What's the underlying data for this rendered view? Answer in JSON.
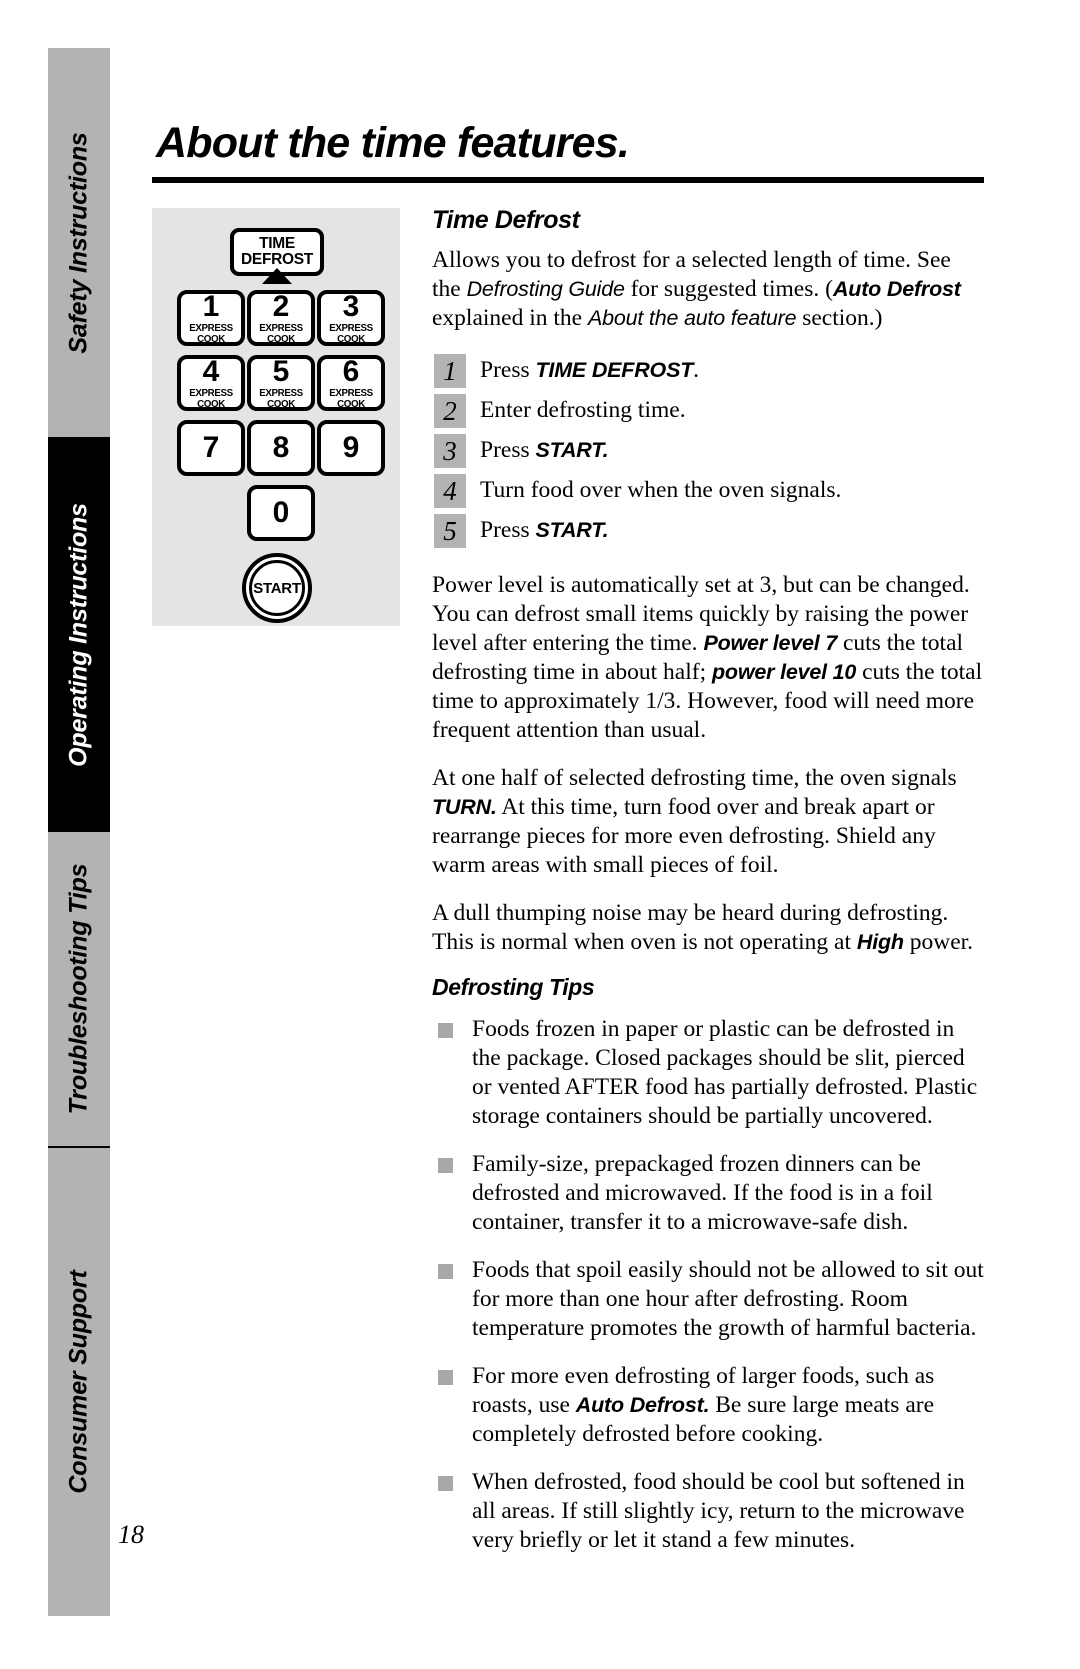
{
  "sidebar": {
    "tabs": [
      {
        "label": "Safety Instructions",
        "style": "gray"
      },
      {
        "label": "Operating Instructions",
        "style": "black"
      },
      {
        "label": "Troubleshooting Tips",
        "style": "gray"
      },
      {
        "label": "Consumer Support",
        "style": "gray"
      }
    ]
  },
  "header": {
    "title": "About the time features."
  },
  "keypad": {
    "time_defrost_line1": "TIME",
    "time_defrost_line2": "DEFROST",
    "express_cook_label": "EXPRESS COOK",
    "keys": [
      {
        "digit": "1",
        "sub": "EXPRESS COOK"
      },
      {
        "digit": "2",
        "sub": "EXPRESS COOK"
      },
      {
        "digit": "3",
        "sub": "EXPRESS COOK"
      },
      {
        "digit": "4",
        "sub": "EXPRESS COOK"
      },
      {
        "digit": "5",
        "sub": "EXPRESS COOK"
      },
      {
        "digit": "6",
        "sub": "EXPRESS COOK"
      },
      {
        "digit": "7",
        "sub": ""
      },
      {
        "digit": "8",
        "sub": ""
      },
      {
        "digit": "9",
        "sub": ""
      },
      {
        "digit": "0",
        "sub": ""
      }
    ],
    "start_label": "START"
  },
  "content": {
    "section_title": "Time Defrost",
    "intro": {
      "p1": "Allows you to defrost for a selected length of time. See the ",
      "p2": "Defrosting Guide",
      "p3": " for suggested times. (",
      "p4": "Auto Defrost",
      "p5": " explained in the ",
      "p6": "About the auto feature",
      "p7": " section.)"
    },
    "steps": [
      {
        "num": "1",
        "pre": "Press ",
        "strong": "TIME DEFROST",
        "post": "."
      },
      {
        "num": "2",
        "pre": "Enter defrosting time.",
        "strong": "",
        "post": ""
      },
      {
        "num": "3",
        "pre": "Press ",
        "strong": "START.",
        "post": ""
      },
      {
        "num": "4",
        "pre": "Turn food over when the oven signals.",
        "strong": "",
        "post": ""
      },
      {
        "num": "5",
        "pre": "Press ",
        "strong": "START.",
        "post": ""
      }
    ],
    "para_power": {
      "a": "Power level is automatically set at 3, but can be changed. You can defrost small items quickly by raising the power level after entering the time. ",
      "b": "Power level 7",
      "c": " cuts the total defrosting time in about half; ",
      "d": "power level 10",
      "e": " cuts the total time to approximately 1/3. However, food will need more frequent attention than usual."
    },
    "para_turn": {
      "a": "At one half of selected defrosting time, the oven signals ",
      "b": "TURN.",
      "c": " At this time, turn food over and break apart or rearrange pieces for more even defrosting. Shield any warm areas with small pieces of foil."
    },
    "para_noise": {
      "a": "A dull thumping noise may be heard during defrosting. This is normal when oven is not operating at ",
      "b": "High",
      "c": " power."
    },
    "tips_title": "Defrosting Tips",
    "tips": [
      {
        "a": "Foods frozen in paper or plastic can be defrosted in the package. Closed packages should be slit, pierced or vented AFTER food has partially defrosted. Plastic storage containers should be partially uncovered.",
        "b": "",
        "c": ""
      },
      {
        "a": "Family-size, prepackaged frozen dinners can be defrosted and microwaved. If the food is in a foil container, transfer it to a microwave-safe dish.",
        "b": "",
        "c": ""
      },
      {
        "a": "Foods that spoil easily should not be allowed to sit out for more than one hour after defrosting. Room temperature promotes the growth of harmful bacteria.",
        "b": "",
        "c": ""
      },
      {
        "a": "For more even defrosting of larger foods, such as roasts, use ",
        "b": "Auto Defrost.",
        "c": " Be sure large meats are completely defrosted before cooking."
      },
      {
        "a": "When defrosted, food should be cool but softened in all areas. If still slightly icy, return to the microwave very briefly or let it stand a few minutes.",
        "b": "",
        "c": ""
      }
    ]
  },
  "footer": {
    "page_number": "18"
  }
}
